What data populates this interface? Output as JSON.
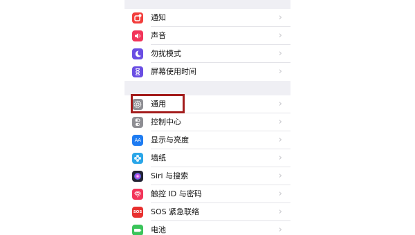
{
  "settings": {
    "group1": [
      {
        "label": "通知",
        "icon": "notifications-icon",
        "color": "#f23e3c"
      },
      {
        "label": "声音",
        "icon": "sounds-icon",
        "color": "#f2355a"
      },
      {
        "label": "勿扰模式",
        "icon": "moon-icon",
        "color": "#6a4ee3"
      },
      {
        "label": "屏幕使用时间",
        "icon": "hourglass-icon",
        "color": "#6a4ee3"
      }
    ],
    "group2": [
      {
        "label": "通用",
        "icon": "gear-icon",
        "color": "#8e8e93"
      },
      {
        "label": "控制中心",
        "icon": "toggles-icon",
        "color": "#8e8e93"
      },
      {
        "label": "显示与亮度",
        "icon": "text-size-icon",
        "color": "#1e7cf2",
        "glyph": "AA"
      },
      {
        "label": "墙纸",
        "icon": "wallpaper-flower-icon",
        "color": "#2aa6e8"
      },
      {
        "label": "Siri 与搜索",
        "icon": "siri-icon",
        "color": "#222233"
      },
      {
        "label": "触控 ID 与密码",
        "icon": "fingerprint-icon",
        "color": "#f2355a"
      },
      {
        "label": "SOS 紧急联络",
        "icon": "sos-icon",
        "color": "#e8302f",
        "glyph": "SOS"
      },
      {
        "label": "电池",
        "icon": "battery-icon",
        "color": "#3ac45a"
      }
    ],
    "chevron": "›",
    "highlight_color": "#a31c1c"
  }
}
